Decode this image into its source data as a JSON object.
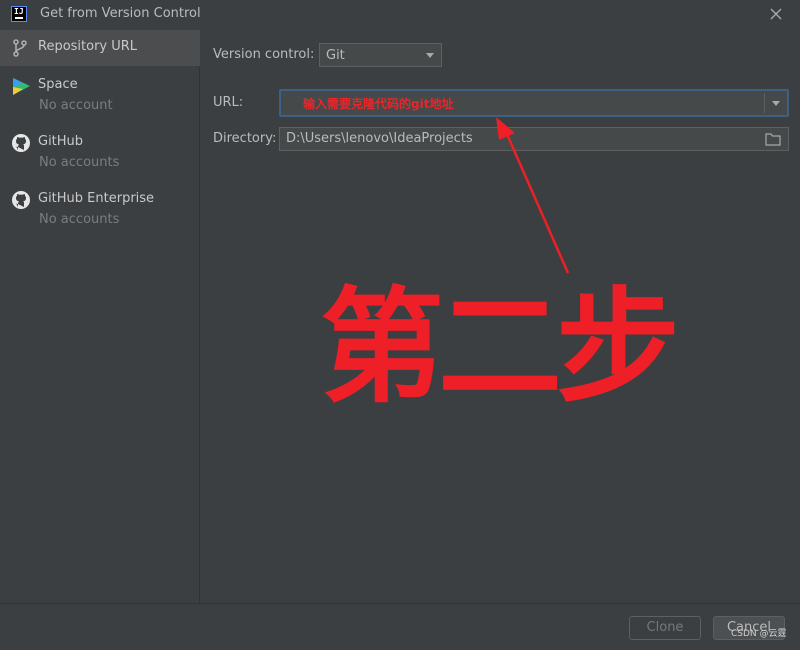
{
  "window": {
    "title": "Get from Version Control"
  },
  "sidebar": {
    "items": [
      {
        "label": "Repository URL",
        "sub": "",
        "icon": "branch-icon",
        "selected": true
      },
      {
        "label": "Space",
        "sub": "No account",
        "icon": "space-icon"
      },
      {
        "label": "GitHub",
        "sub": "No accounts",
        "icon": "github-icon"
      },
      {
        "label": "GitHub Enterprise",
        "sub": "No accounts",
        "icon": "github-icon"
      }
    ]
  },
  "form": {
    "vc_label": "Version control:",
    "vc_value": "Git",
    "url_label": "URL:",
    "url_hint": "输入需要克隆代码的git地址",
    "dir_label": "Directory:",
    "dir_value": "D:\\Users\\lenovo\\IdeaProjects"
  },
  "annotation": {
    "step_text": "第二步",
    "color": "#ee1f26"
  },
  "footer": {
    "clone_label": "Clone",
    "cancel_label": "Cancel",
    "watermark": "CSDN @云霆"
  },
  "colors": {
    "background": "#3c3f41",
    "selected": "#4b4d4f",
    "focus_border": "#3d6185"
  }
}
